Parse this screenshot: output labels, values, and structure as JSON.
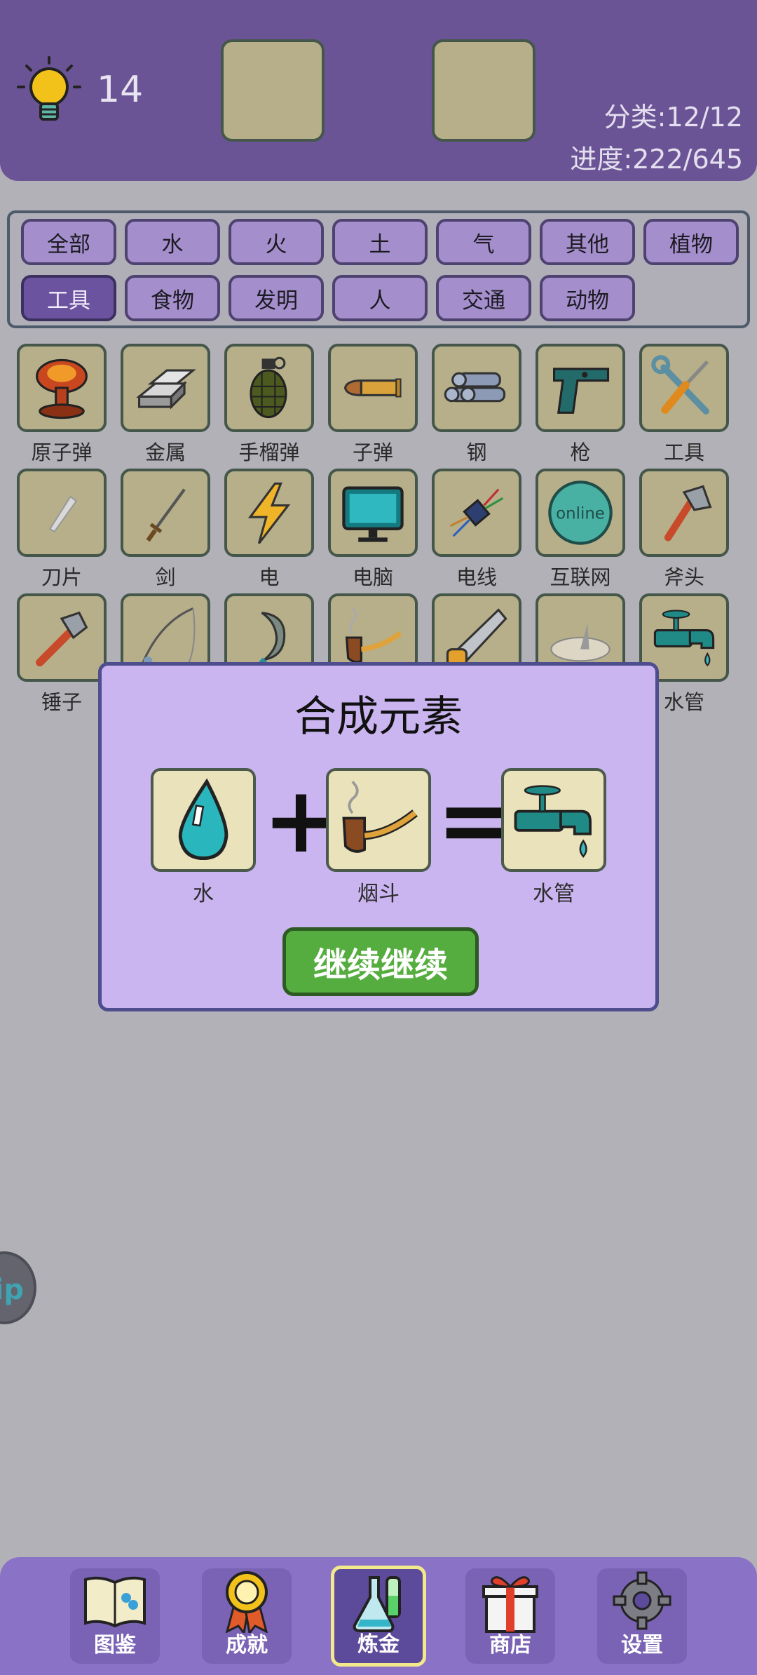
{
  "header": {
    "hints": "14",
    "category_stat": "分类:12/12",
    "progress_stat": "进度:222/645"
  },
  "filters": [
    {
      "label": "全部",
      "active": false
    },
    {
      "label": "水",
      "active": false
    },
    {
      "label": "火",
      "active": false
    },
    {
      "label": "土",
      "active": false
    },
    {
      "label": "气",
      "active": false
    },
    {
      "label": "其他",
      "active": false
    },
    {
      "label": "植物",
      "active": false
    },
    {
      "label": "工具",
      "active": true
    },
    {
      "label": "食物",
      "active": false
    },
    {
      "label": "发明",
      "active": false
    },
    {
      "label": "人",
      "active": false
    },
    {
      "label": "交通",
      "active": false
    },
    {
      "label": "动物",
      "active": false
    }
  ],
  "elements": [
    {
      "label": "原子弹",
      "icon": "mushroom-cloud-icon"
    },
    {
      "label": "金属",
      "icon": "metal-ingots-icon"
    },
    {
      "label": "手榴弹",
      "icon": "grenade-icon"
    },
    {
      "label": "子弹",
      "icon": "bullet-icon"
    },
    {
      "label": "钢",
      "icon": "steel-pipes-icon"
    },
    {
      "label": "枪",
      "icon": "pistol-icon"
    },
    {
      "label": "工具",
      "icon": "wrench-screwdriver-icon"
    },
    {
      "label": "刀片",
      "icon": "blade-icon"
    },
    {
      "label": "剑",
      "icon": "sword-icon"
    },
    {
      "label": "电",
      "icon": "lightning-icon"
    },
    {
      "label": "电脑",
      "icon": "monitor-icon"
    },
    {
      "label": "电线",
      "icon": "wires-icon"
    },
    {
      "label": "互联网",
      "icon": "online-icon"
    },
    {
      "label": "斧头",
      "icon": "axe-icon"
    },
    {
      "label": "锤子",
      "icon": "hammer-icon"
    },
    {
      "label": "",
      "icon": "fishing-rod-icon"
    },
    {
      "label": "",
      "icon": "sickle-icon"
    },
    {
      "label": "",
      "icon": "pipe-icon"
    },
    {
      "label": "",
      "icon": "saw-icon"
    },
    {
      "label": "",
      "icon": "sundial-icon"
    },
    {
      "label": "水管",
      "icon": "faucet-icon"
    }
  ],
  "side_tab": {
    "text": "ip"
  },
  "modal": {
    "title": "合成元素",
    "input1": {
      "label": "水",
      "icon": "water-drop-icon"
    },
    "input2": {
      "label": "烟斗",
      "icon": "pipe-icon"
    },
    "result": {
      "label": "水管",
      "icon": "faucet-icon"
    },
    "plus": "+",
    "equals": "=",
    "button": "继续继续"
  },
  "nav": [
    {
      "label": "图鉴",
      "icon": "book-icon",
      "active": false
    },
    {
      "label": "成就",
      "icon": "medal-icon",
      "active": false
    },
    {
      "label": "炼金",
      "icon": "flask-icon",
      "active": true
    },
    {
      "label": "商店",
      "icon": "gift-icon",
      "active": false
    },
    {
      "label": "设置",
      "icon": "gear-icon",
      "active": false
    }
  ]
}
